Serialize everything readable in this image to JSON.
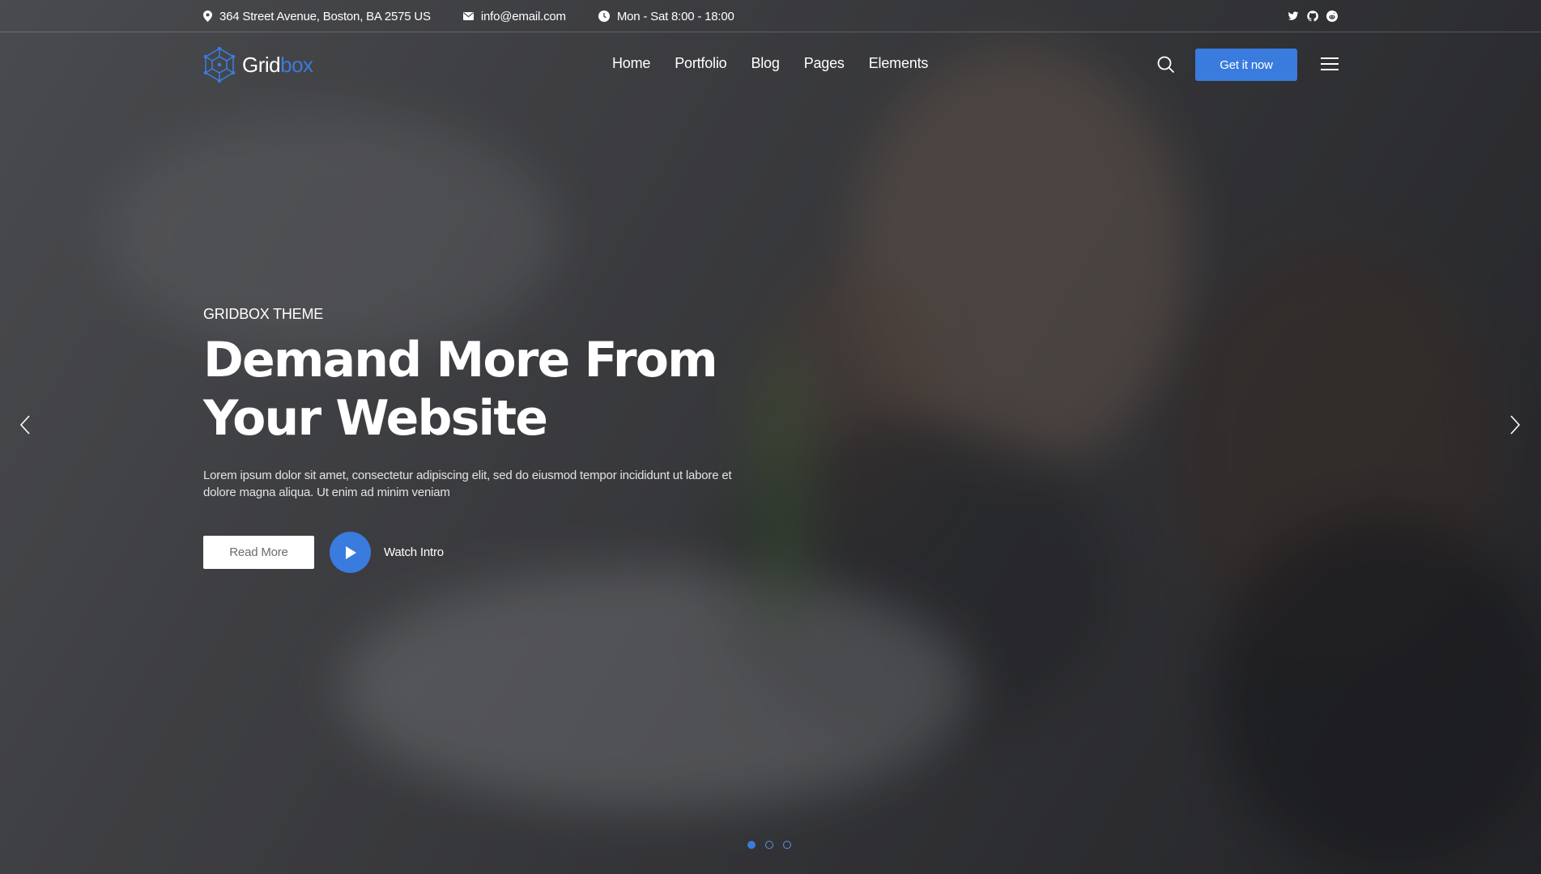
{
  "colors": {
    "accent": "#3a7bde",
    "white": "#ffffff"
  },
  "topbar": {
    "address": {
      "icon": "map-pin-icon",
      "text": "364 Street Avenue, Boston, BA 2575 US"
    },
    "email": {
      "icon": "envelope-icon",
      "text": "info@email.com"
    },
    "hours": {
      "icon": "clock-icon",
      "text": "Mon - Sat 8:00 - 18:00"
    },
    "social": [
      "twitter-icon",
      "github-icon",
      "reddit-icon"
    ]
  },
  "header": {
    "logo": {
      "part1": "Grid",
      "part2": "box",
      "icon": "hexagon-network-icon"
    },
    "nav": [
      "Home",
      "Portfolio",
      "Blog",
      "Pages",
      "Elements"
    ],
    "search_icon": "search-icon",
    "cta_label": "Get it now",
    "menu_icon": "hamburger-menu-icon"
  },
  "hero": {
    "eyebrow": "GRIDBOX THEME",
    "headline_line1": "Demand More From",
    "headline_line2": "Your Website",
    "lead": "Lorem ipsum dolor sit amet, consectetur adipiscing elit, sed do eiusmod tempor incididunt ut labore et dolore magna aliqua. Ut enim ad minim veniam",
    "read_more_label": "Read More",
    "watch_label": "Watch Intro",
    "play_icon": "play-icon"
  },
  "slider": {
    "prev_icon": "chevron-left-icon",
    "next_icon": "chevron-right-icon",
    "slide_count": 3,
    "active_slide": 1
  }
}
